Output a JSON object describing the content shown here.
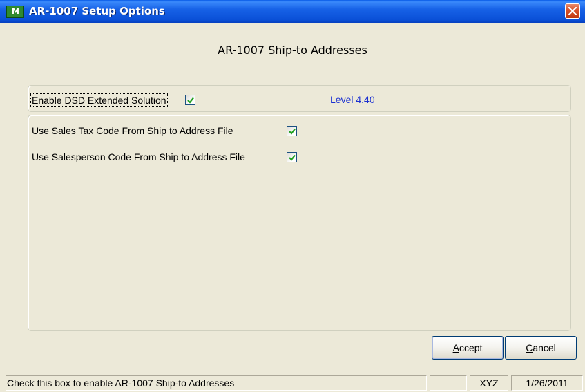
{
  "window": {
    "app_icon_text": "M",
    "title": "AR-1007  Setup Options"
  },
  "heading": "AR-1007 Ship-to Addresses",
  "options": {
    "enable_dsd": {
      "label": "Enable DSD Extended Solution",
      "checked": true
    },
    "level_text": "Level  4.40",
    "use_sales_tax": {
      "label": "Use Sales Tax Code From Ship to Address File",
      "checked": true
    },
    "use_salesperson": {
      "label": "Use Salesperson Code From Ship to Address File",
      "checked": true
    }
  },
  "buttons": {
    "accept": {
      "mnemonic": "A",
      "rest": "ccept"
    },
    "cancel": {
      "mnemonic": "C",
      "rest": "ancel"
    }
  },
  "status": {
    "message": "Check this box to enable AR-1007 Ship-to Addresses",
    "blank": "",
    "user": "XYZ",
    "date": "1/26/2011"
  },
  "colors": {
    "title_bar": "#1762e7",
    "level_text": "#1a2fd0",
    "checkmark": "#21a121",
    "close_button": "#d9542c"
  },
  "icons": [
    "app-logo-icon",
    "close-icon",
    "checkmark-icon"
  ]
}
